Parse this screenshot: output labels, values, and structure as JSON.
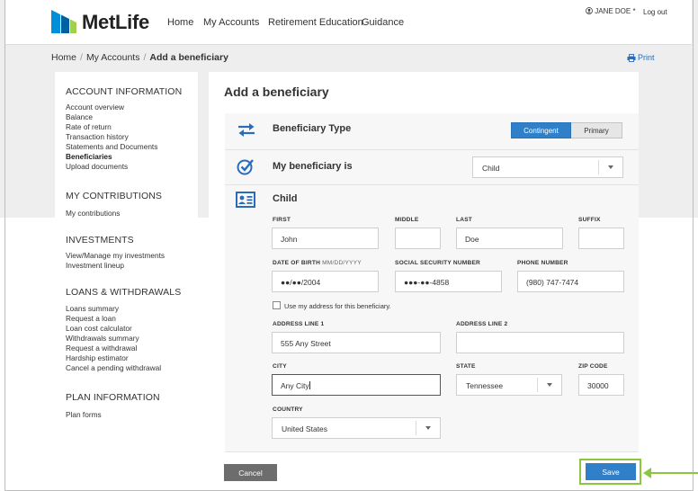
{
  "brand": {
    "name": "MetLife",
    "colors": {
      "blue": "#1e88c8",
      "green": "#8cc63f",
      "accent": "#2f80c9"
    }
  },
  "nav": {
    "items": [
      "Home",
      "My Accounts",
      "Retirement Education",
      "Guidance"
    ]
  },
  "user": {
    "name": "JANE DOE *",
    "logout": "Log out"
  },
  "breadcrumb": {
    "home": "Home",
    "accounts": "My Accounts",
    "current": "Add a beneficiary"
  },
  "print_label": "Print",
  "sidebar": {
    "sections": [
      {
        "title": "ACCOUNT INFORMATION",
        "items": [
          "Account overview",
          "Balance",
          "Rate of return",
          "Transaction history",
          "Statements and Documents",
          "Beneficiaries",
          "Upload documents"
        ],
        "active": "Beneficiaries"
      },
      {
        "title": "MY CONTRIBUTIONS",
        "items": [
          "My contributions"
        ]
      },
      {
        "title": "INVESTMENTS",
        "items": [
          "View/Manage my investments",
          "Investment lineup"
        ]
      },
      {
        "title": "LOANS & WITHDRAWALS",
        "items": [
          "Loans summary",
          "Request a loan",
          "Loan cost calculator",
          "Withdrawals summary",
          "Request a withdrawal",
          "Hardship estimator",
          "Cancel a pending withdrawal"
        ]
      },
      {
        "title": "PLAN INFORMATION",
        "items": [
          "Plan forms"
        ]
      }
    ]
  },
  "form": {
    "title": "Add a beneficiary",
    "type": {
      "label": "Beneficiary Type",
      "options": [
        "Contingent",
        "Primary"
      ],
      "selected": "Contingent"
    },
    "relationship": {
      "label": "My beneficiary is",
      "value": "Child"
    },
    "details": {
      "heading": "Child",
      "first": {
        "label": "FIRST",
        "value": "John"
      },
      "middle": {
        "label": "MIDDLE",
        "value": ""
      },
      "last": {
        "label": "LAST",
        "value": "Doe"
      },
      "suffix": {
        "label": "SUFFIX",
        "value": ""
      },
      "dob": {
        "label": "DATE OF BIRTH",
        "hint": "MM/DD/YYYY",
        "value": "●●/●●/2004"
      },
      "ssn": {
        "label": "SOCIAL SECURITY NUMBER",
        "value": "●●●-●●-4858"
      },
      "phone": {
        "label": "PHONE NUMBER",
        "value": "(980) 747-7474"
      },
      "use_address": {
        "label": "Use my address for this beneficiary.",
        "checked": false
      },
      "address1": {
        "label": "ADDRESS LINE 1",
        "value": "555 Any Street"
      },
      "address2": {
        "label": "ADDRESS LINE 2",
        "value": ""
      },
      "city": {
        "label": "CITY",
        "value": "Any City"
      },
      "state": {
        "label": "STATE",
        "value": "Tennessee"
      },
      "zip": {
        "label": "ZIP CODE",
        "value": "30000"
      },
      "country": {
        "label": "COUNTRY",
        "value": "United States"
      }
    },
    "actions": {
      "cancel": "Cancel",
      "save": "Save"
    }
  }
}
